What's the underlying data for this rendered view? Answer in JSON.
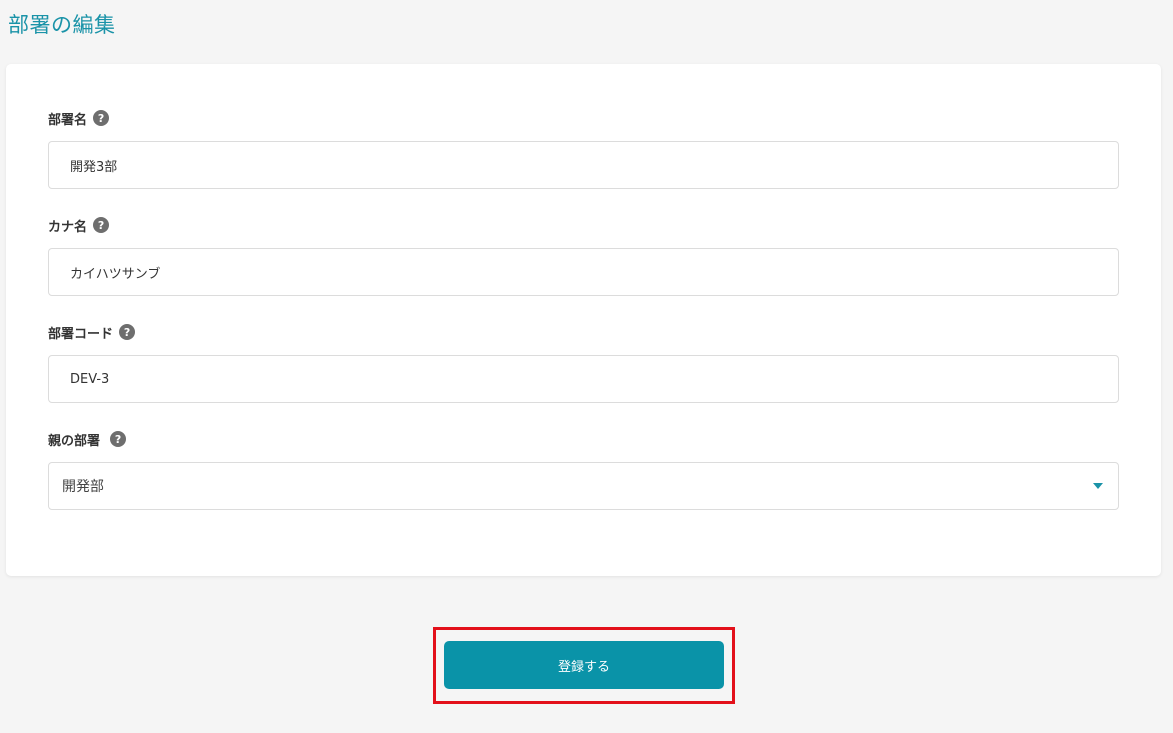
{
  "page": {
    "title": "部署の編集"
  },
  "form": {
    "department_name": {
      "label": "部署名",
      "value": "開発3部"
    },
    "kana_name": {
      "label": "カナ名",
      "value": "カイハツサンブ"
    },
    "department_code": {
      "label": "部署コード",
      "value": "DEV-3"
    },
    "parent_department": {
      "label": "親の部署",
      "selected": "開発部"
    },
    "help_glyph": "?"
  },
  "actions": {
    "submit_label": "登録する"
  },
  "colors": {
    "accent": "#0a93a8",
    "title": "#1a93a8",
    "highlight": "#e3101a",
    "background": "#f5f5f5"
  },
  "icons": {
    "help": "question-circle-icon",
    "dropdown": "caret-down-icon"
  }
}
